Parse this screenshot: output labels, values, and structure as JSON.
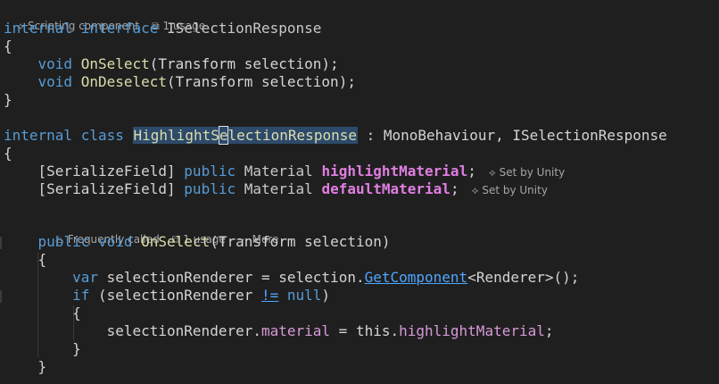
{
  "lens1": {
    "component": "Scripting component",
    "usages": "1 usage"
  },
  "lens2": {
    "frequent": "Frequently called",
    "usages": "1 usage",
    "more": "More"
  },
  "icons": {
    "unity": "unity-icon",
    "usage": "usage-icon",
    "fire": "fire-icon",
    "more": "ellipsis-icon"
  },
  "code": {
    "l1": {
      "internal": "internal",
      "interface": "interface",
      "name": "ISelectionResponse"
    },
    "brace_open": "{",
    "brace_close": "}",
    "l3": {
      "void": "void",
      "method": "OnSelect",
      "params": "(Transform selection);"
    },
    "l4": {
      "void": "void",
      "method": "OnDeselect",
      "params": "(Transform selection);"
    },
    "l7": {
      "internal": "internal",
      "class": "class",
      "name_a": "HighlightS",
      "name_cursor": "e",
      "name_b": "lectionResponse",
      "rest": " : MonoBehaviour, ISelectionResponse"
    },
    "l9": {
      "attr": "[SerializeField]",
      "public": "public",
      "type": "Material",
      "field": "highlightMaterial",
      "semi": ";",
      "hint": "Set by Unity"
    },
    "l10": {
      "attr": "[SerializeField]",
      "public": "public",
      "type": "Material",
      "field": "defaultMaterial",
      "semi": ";",
      "hint": "Set by Unity"
    },
    "l12": {
      "public": "public",
      "void": "void",
      "method": "OnSelect",
      "params": "(Transform selection)"
    },
    "l14": {
      "var": "var",
      "rest1": " selectionRenderer = selection.",
      "method": "GetComponent",
      "rest2": "<Renderer>();"
    },
    "l15": {
      "if": "if",
      "rest1": " (selectionRenderer ",
      "op": "!=",
      "space": " ",
      "null": "null",
      "rest2": ")"
    },
    "l17": {
      "obj": "selectionRenderer.",
      "member": "material",
      "rest": " = this.",
      "field": "highlightMaterial",
      "semi": ";"
    }
  }
}
